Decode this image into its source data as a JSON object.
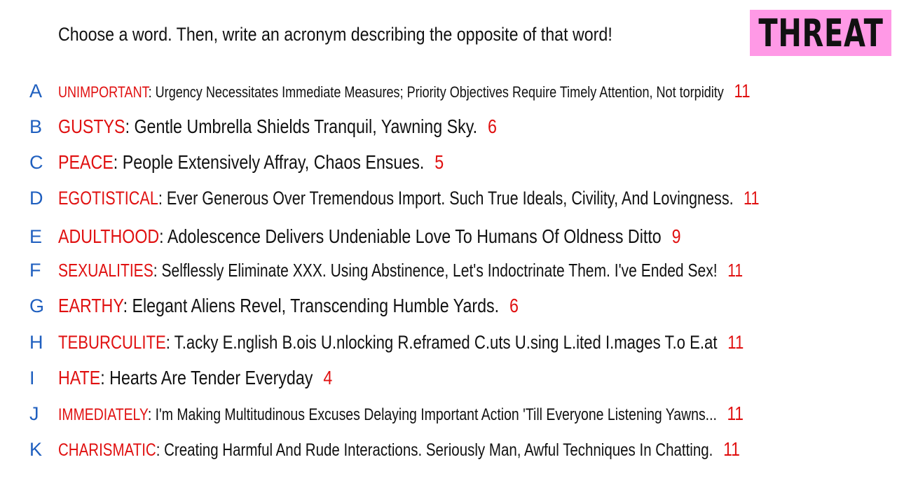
{
  "instructions": "Choose a word. Then, write an acronym describing the opposite of that word!",
  "badge": "THREAT",
  "colors": {
    "letter": "#1f5fbf",
    "word": "#e01010",
    "text": "#111111",
    "badge_bg": "#ff99e6"
  },
  "entries": [
    {
      "letter": "A",
      "word": "UNIMPORTANT",
      "acronym": "Urgency Necessitates Immediate Measures; Priority Objectives Require Timely Attention, Not torpidity",
      "count": "11"
    },
    {
      "letter": "B",
      "word": "GUSTYS",
      "acronym": "Gentle Umbrella Shields Tranquil, Yawning Sky.",
      "count": "6"
    },
    {
      "letter": "C",
      "word": "PEACE",
      "acronym": "People Extensively Affray, Chaos Ensues.",
      "count": "5"
    },
    {
      "letter": "D",
      "word": "EGOTISTICAL",
      "acronym": "Ever Generous Over Tremendous Import. Such True Ideals, Civility, And Lovingness.",
      "count": "11"
    },
    {
      "letter": "E",
      "word": "ADULTHOOD",
      "acronym": "Adolescence Delivers Undeniable Love To Humans Of Oldness Ditto",
      "count": "9"
    },
    {
      "letter": "F",
      "word": "SEXUALITIES",
      "acronym": "Selflessly Eliminate XXX. Using Abstinence, Let's Indoctrinate Them. I've Ended Sex!",
      "count": "11"
    },
    {
      "letter": "G",
      "word": "EARTHY",
      "acronym": "Elegant Aliens Revel, Transcending Humble Yards.",
      "count": "6"
    },
    {
      "letter": "H",
      "word": "TEBURCULITE",
      "acronym": "T.acky E.nglish B.ois U.nlocking R.eframed C.uts U.sing L.ited I.mages T.o E.at",
      "count": "11"
    },
    {
      "letter": "I",
      "word": "HATE",
      "acronym": "Hearts Are Tender Everyday",
      "count": "4"
    },
    {
      "letter": "J",
      "word": "IMMEDIATELY",
      "acronym": "I'm Making Multitudinous Excuses Delaying Important Action 'Till Everyone Listening Yawns...",
      "count": "11"
    },
    {
      "letter": "K",
      "word": "CHARISMATIC",
      "acronym": "Creating Harmful And Rude Interactions. Seriously Man, Awful Techniques In Chatting.",
      "count": "11"
    }
  ]
}
